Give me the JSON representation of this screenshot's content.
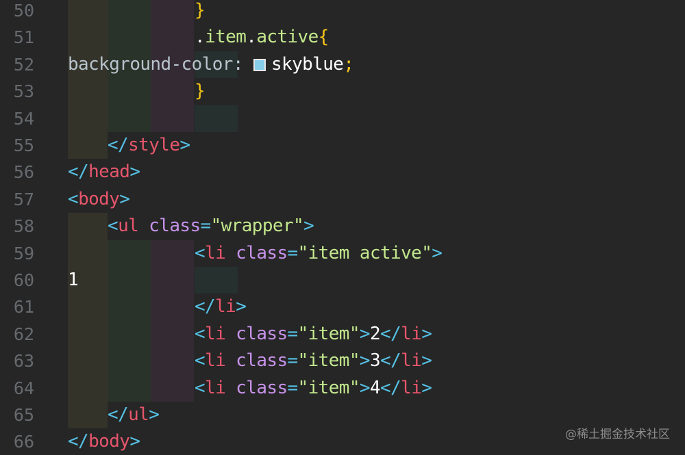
{
  "editor": {
    "theme_colors": {
      "background": "#262626",
      "line_number": "#666a6e",
      "tag_bracket": "#56c2e6",
      "tag_name": "#e7566c",
      "attribute": "#c792ea",
      "string": "#c3e88d",
      "brace": "#f5c518",
      "swatch": "#87ceeb"
    },
    "lines": [
      {
        "n": "50",
        "parts": [
          {
            "t": "}",
            "c": "yellow"
          }
        ]
      },
      {
        "n": "51",
        "parts": [
          {
            "t": ".",
            "c": "white"
          },
          {
            "t": "item",
            "c": "sel"
          },
          {
            "t": ".",
            "c": "white"
          },
          {
            "t": "active",
            "c": "sel"
          },
          {
            "t": "{",
            "c": "yellow"
          }
        ]
      },
      {
        "n": "52",
        "parts": [
          {
            "t": "background-color: ",
            "c": "prop"
          },
          {
            "t": "",
            "c": "swatch",
            "color": "#87ceeb"
          },
          {
            "t": "skyblue",
            "c": "white"
          },
          {
            "t": ";",
            "c": "yellow"
          }
        ]
      },
      {
        "n": "53",
        "parts": [
          {
            "t": "}",
            "c": "yellow"
          }
        ]
      },
      {
        "n": "54",
        "parts": []
      },
      {
        "n": "55",
        "parts": [
          {
            "t": "</",
            "c": "cyan"
          },
          {
            "t": "style",
            "c": "red"
          },
          {
            "t": ">",
            "c": "cyan"
          }
        ]
      },
      {
        "n": "56",
        "parts": [
          {
            "t": "</",
            "c": "cyan"
          },
          {
            "t": "head",
            "c": "red"
          },
          {
            "t": ">",
            "c": "cyan"
          }
        ]
      },
      {
        "n": "57",
        "parts": [
          {
            "t": "<",
            "c": "cyan"
          },
          {
            "t": "body",
            "c": "red"
          },
          {
            "t": ">",
            "c": "cyan"
          }
        ]
      },
      {
        "n": "58",
        "parts": [
          {
            "t": "<",
            "c": "cyan"
          },
          {
            "t": "ul ",
            "c": "red"
          },
          {
            "t": "class",
            "c": "purple"
          },
          {
            "t": "=",
            "c": "cyan"
          },
          {
            "t": "\"wrapper\"",
            "c": "green"
          },
          {
            "t": ">",
            "c": "cyan"
          }
        ]
      },
      {
        "n": "59",
        "parts": [
          {
            "t": "<",
            "c": "cyan"
          },
          {
            "t": "li ",
            "c": "red"
          },
          {
            "t": "class",
            "c": "purple"
          },
          {
            "t": "=",
            "c": "cyan"
          },
          {
            "t": "\"item active\"",
            "c": "green"
          },
          {
            "t": ">",
            "c": "cyan"
          }
        ]
      },
      {
        "n": "60",
        "parts": [
          {
            "t": "1",
            "c": "white"
          }
        ]
      },
      {
        "n": "61",
        "parts": [
          {
            "t": "</",
            "c": "cyan"
          },
          {
            "t": "li",
            "c": "red"
          },
          {
            "t": ">",
            "c": "cyan"
          }
        ]
      },
      {
        "n": "62",
        "parts": [
          {
            "t": "<",
            "c": "cyan"
          },
          {
            "t": "li ",
            "c": "red"
          },
          {
            "t": "class",
            "c": "purple"
          },
          {
            "t": "=",
            "c": "cyan"
          },
          {
            "t": "\"item\"",
            "c": "green"
          },
          {
            "t": ">",
            "c": "cyan"
          },
          {
            "t": "2",
            "c": "white"
          },
          {
            "t": "</",
            "c": "cyan"
          },
          {
            "t": "li",
            "c": "red"
          },
          {
            "t": ">",
            "c": "cyan"
          }
        ]
      },
      {
        "n": "63",
        "parts": [
          {
            "t": "<",
            "c": "cyan"
          },
          {
            "t": "li ",
            "c": "red"
          },
          {
            "t": "class",
            "c": "purple"
          },
          {
            "t": "=",
            "c": "cyan"
          },
          {
            "t": "\"item\"",
            "c": "green"
          },
          {
            "t": ">",
            "c": "cyan"
          },
          {
            "t": "3",
            "c": "white"
          },
          {
            "t": "</",
            "c": "cyan"
          },
          {
            "t": "li",
            "c": "red"
          },
          {
            "t": ">",
            "c": "cyan"
          }
        ]
      },
      {
        "n": "64",
        "parts": [
          {
            "t": "<",
            "c": "cyan"
          },
          {
            "t": "li ",
            "c": "red"
          },
          {
            "t": "class",
            "c": "purple"
          },
          {
            "t": "=",
            "c": "cyan"
          },
          {
            "t": "\"item\"",
            "c": "green"
          },
          {
            "t": ">",
            "c": "cyan"
          },
          {
            "t": "4",
            "c": "white"
          },
          {
            "t": "</",
            "c": "cyan"
          },
          {
            "t": "li",
            "c": "red"
          },
          {
            "t": ">",
            "c": "cyan"
          }
        ]
      },
      {
        "n": "65",
        "parts": [
          {
            "t": "</",
            "c": "cyan"
          },
          {
            "t": "ul",
            "c": "red"
          },
          {
            "t": ">",
            "c": "cyan"
          }
        ]
      },
      {
        "n": "66",
        "parts": [
          {
            "t": "</",
            "c": "cyan"
          },
          {
            "t": "body",
            "c": "red"
          },
          {
            "t": ">",
            "c": "cyan"
          }
        ]
      }
    ]
  },
  "watermark": "@稀土掘金技术社区"
}
